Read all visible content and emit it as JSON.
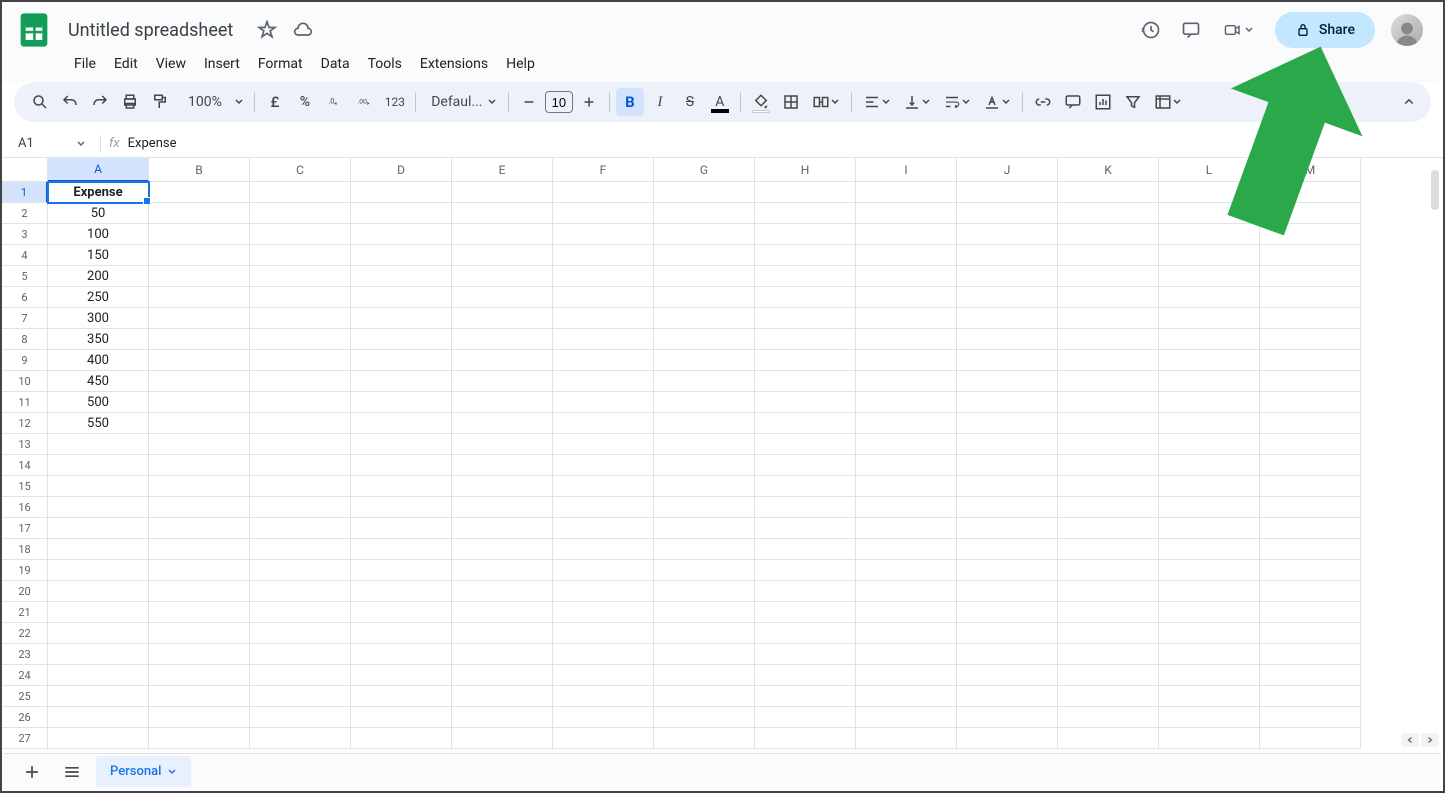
{
  "doc": {
    "title": "Untitled spreadsheet"
  },
  "menus": [
    "File",
    "Edit",
    "View",
    "Insert",
    "Format",
    "Data",
    "Tools",
    "Extensions",
    "Help"
  ],
  "share": {
    "label": "Share"
  },
  "toolbar": {
    "zoom": "100%",
    "font": "Defaul...",
    "fontSize": "10",
    "numberFormat": "123"
  },
  "nameBox": "A1",
  "formula": "Expense",
  "columns": [
    "A",
    "B",
    "C",
    "D",
    "E",
    "F",
    "G",
    "H",
    "I",
    "J",
    "K",
    "L",
    "M"
  ],
  "rowCount": 27,
  "cells": {
    "A1": "Expense",
    "A2": "50",
    "A3": "100",
    "A4": "150",
    "A5": "200",
    "A6": "250",
    "A7": "300",
    "A8": "350",
    "A9": "400",
    "A10": "450",
    "A11": "500",
    "A12": "550"
  },
  "selectedCell": "A1",
  "sheet": {
    "name": "Personal"
  },
  "chart_data": {
    "type": "table",
    "title": "Expense",
    "categories": [
      "Row 2",
      "Row 3",
      "Row 4",
      "Row 5",
      "Row 6",
      "Row 7",
      "Row 8",
      "Row 9",
      "Row 10",
      "Row 11",
      "Row 12"
    ],
    "values": [
      50,
      100,
      150,
      200,
      250,
      300,
      350,
      400,
      450,
      500,
      550
    ]
  }
}
